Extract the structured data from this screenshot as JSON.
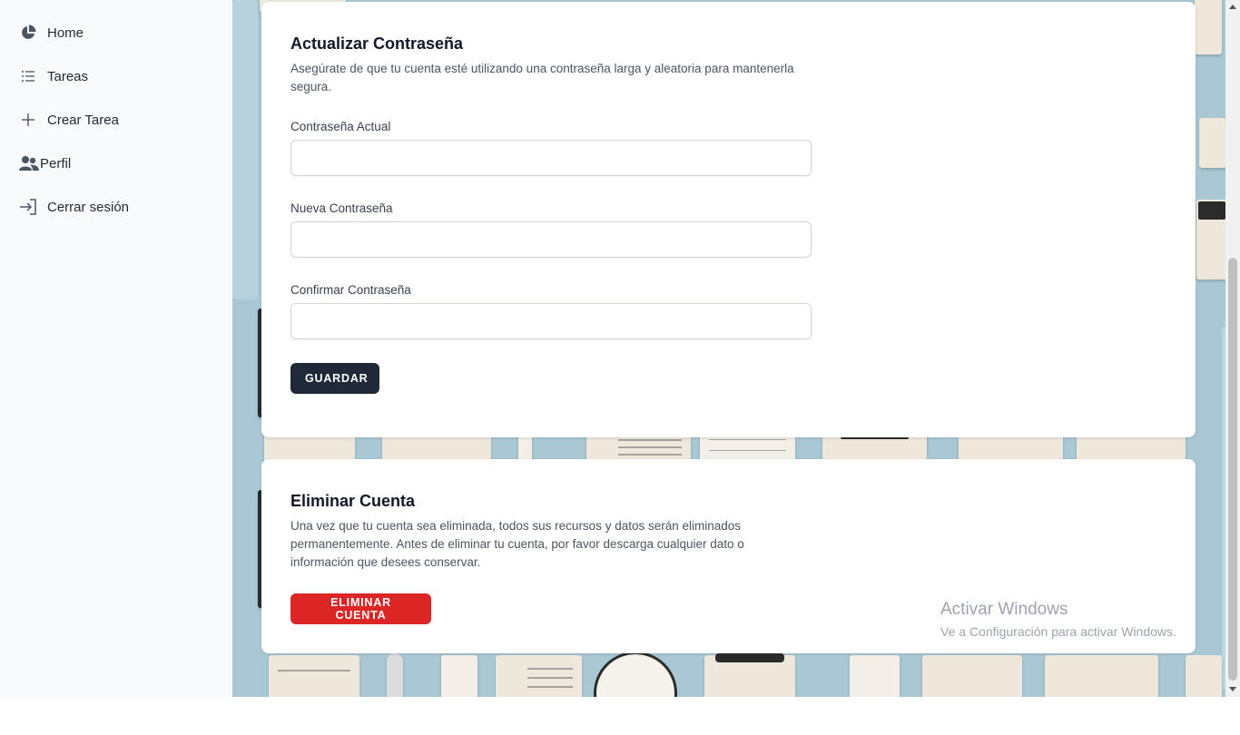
{
  "sidebar": {
    "items": [
      {
        "label": "Home",
        "icon": "pie-chart-icon"
      },
      {
        "label": "Tareas",
        "icon": "list-icon"
      },
      {
        "label": "Crear Tarea",
        "icon": "plus-icon"
      },
      {
        "label": "Perfil",
        "icon": "users-icon"
      },
      {
        "label": "Cerrar sesión",
        "icon": "sign-in-icon"
      }
    ]
  },
  "password_card": {
    "title": "Actualizar Contraseña",
    "description": "Asegúrate de que tu cuenta esté utilizando una contraseña larga y aleatoria para mantenerla segura.",
    "fields": [
      {
        "label": "Contraseña Actual",
        "value": ""
      },
      {
        "label": "Nueva Contraseña",
        "value": ""
      },
      {
        "label": "Confirmar Contraseña",
        "value": ""
      }
    ],
    "save_label": "GUARDAR"
  },
  "delete_card": {
    "title": "Eliminar Cuenta",
    "description": "Una vez que tu cuenta sea eliminada, todos sus recursos y datos serán eliminados permanentemente. Antes de eliminar tu cuenta, por favor descarga cualquier dato o información que desees conservar.",
    "delete_label": "ELIMINAR CUENTA"
  },
  "watermark": {
    "line1": "Activar Windows",
    "line2": "Ve a Configuración para activar Windows."
  },
  "colors": {
    "save_button": "#1f2937",
    "delete_button": "#dc2626",
    "sidebar_bg": "#f8fafc",
    "pattern_bg": "#a9c8d4"
  }
}
